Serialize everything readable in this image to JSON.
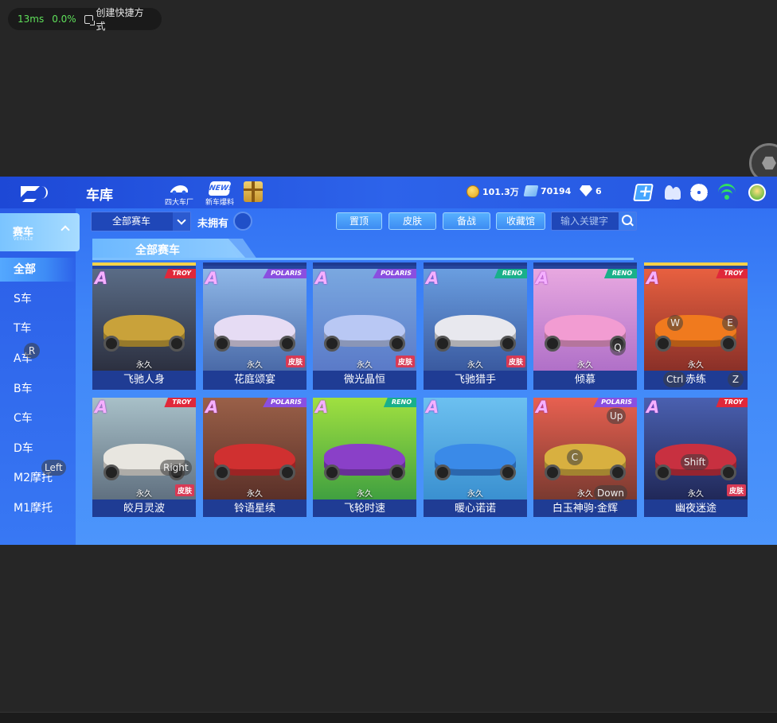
{
  "overlay": {
    "latency": "13ms",
    "loss": "0.0%",
    "shortcut_label": "创建快捷方式"
  },
  "header": {
    "title": "车库",
    "icons": [
      {
        "label": "四大车厂",
        "name": "four-factories"
      },
      {
        "label": "新车爆料",
        "name": "new-car-news",
        "badge": "NEW!"
      }
    ],
    "coins": "101.3万",
    "tickets": "70194",
    "diamonds": "6"
  },
  "sidebar": {
    "category": "赛车",
    "category_sub": "VEHICLE",
    "items": [
      {
        "label": "全部",
        "active": true
      },
      {
        "label": "S车"
      },
      {
        "label": "T车"
      },
      {
        "label": "A车"
      },
      {
        "label": "B车"
      },
      {
        "label": "C车"
      },
      {
        "label": "D车"
      },
      {
        "label": "M2摩托"
      },
      {
        "label": "M1摩托"
      }
    ]
  },
  "filters": {
    "select_value": "全部赛车",
    "not_owned_label": "未拥有",
    "buttons": [
      "置顶",
      "皮肤",
      "备战",
      "收藏馆"
    ],
    "search_placeholder": "输入关键字"
  },
  "section": {
    "title": "全部赛车"
  },
  "cards": [
    {
      "name": "飞驰人身",
      "grade": "A",
      "brand": "TROY",
      "duration": "永久",
      "skin": "",
      "bg": [
        "#5a6c86",
        "#2c3040"
      ],
      "car": "#c9a23a",
      "gold": true
    },
    {
      "name": "花庭颂宴",
      "grade": "A",
      "brand": "POLARIS",
      "duration": "永久",
      "skin": "皮肤",
      "bg": [
        "#8fb8e8",
        "#4a6aa8"
      ],
      "car": "#e6dcf4",
      "gold": false
    },
    {
      "name": "微光晶恒",
      "grade": "A",
      "brand": "POLARIS",
      "duration": "永久",
      "skin": "皮肤",
      "bg": [
        "#7aa8e0",
        "#5a7ac8"
      ],
      "car": "#b9c8f4",
      "gold": false
    },
    {
      "name": "飞驰猎手",
      "grade": "A",
      "brand": "RENO",
      "duration": "永久",
      "skin": "皮肤",
      "bg": [
        "#6a9ee0",
        "#3a5aa0"
      ],
      "car": "#e8e8ee",
      "gold": false
    },
    {
      "name": "倾慕",
      "grade": "A",
      "brand": "RENO",
      "duration": "永久",
      "skin": "",
      "bg": [
        "#e8a8e0",
        "#b070c8"
      ],
      "car": "#f29cd2",
      "gold": false
    },
    {
      "name": "赤练",
      "grade": "A",
      "brand": "TROY",
      "duration": "永久",
      "skin": "",
      "bg": [
        "#e86040",
        "#8a3028"
      ],
      "car": "#f07a1e",
      "gold": true
    },
    {
      "name": "皎月灵波",
      "grade": "A",
      "brand": "TROY",
      "duration": "永久",
      "skin": "皮肤",
      "bg": [
        "#a8c0c8",
        "#607080"
      ],
      "car": "#e8e6e0",
      "gold": false
    },
    {
      "name": "铃语星续",
      "grade": "A",
      "brand": "POLARIS",
      "duration": "永久",
      "skin": "",
      "bg": [
        "#9a6048",
        "#5a3028"
      ],
      "car": "#d03030",
      "gold": false
    },
    {
      "name": "飞轮时速",
      "grade": "A",
      "brand": "RENO",
      "duration": "永久",
      "skin": "",
      "bg": [
        "#a0e040",
        "#40a040"
      ],
      "car": "#8a40c8",
      "gold": false
    },
    {
      "name": "暖心诺诺",
      "grade": "A",
      "brand": "",
      "duration": "永久",
      "skin": "",
      "bg": [
        "#6cc0f0",
        "#3a90d0"
      ],
      "car": "#3a8ae8",
      "gold": false
    },
    {
      "name": "白玉神驹·金辉",
      "grade": "A",
      "brand": "POLARIS",
      "duration": "永久",
      "skin": "",
      "bg": [
        "#e86050",
        "#7a3a30"
      ],
      "car": "#d8b040",
      "gold": false
    },
    {
      "name": "幽夜迷途",
      "grade": "A",
      "brand": "TROY",
      "duration": "永久",
      "skin": "皮肤",
      "bg": [
        "#4a60b0",
        "#202858"
      ],
      "car": "#c83040",
      "gold": false
    }
  ],
  "key_hints": [
    {
      "label": "R",
      "pos": "r"
    },
    {
      "label": "Left",
      "pos": "left"
    },
    {
      "label": "W",
      "pos": "w"
    },
    {
      "label": "E",
      "pos": "e"
    },
    {
      "label": "Q",
      "pos": "q"
    },
    {
      "label": "Ctrl",
      "pos": "ctrl"
    },
    {
      "label": "Z",
      "pos": "z"
    },
    {
      "label": "Right",
      "pos": "right"
    },
    {
      "label": "Up",
      "pos": "up"
    },
    {
      "label": "C",
      "pos": "c"
    },
    {
      "label": "Down",
      "pos": "down"
    },
    {
      "label": "Shift",
      "pos": "shift"
    }
  ]
}
